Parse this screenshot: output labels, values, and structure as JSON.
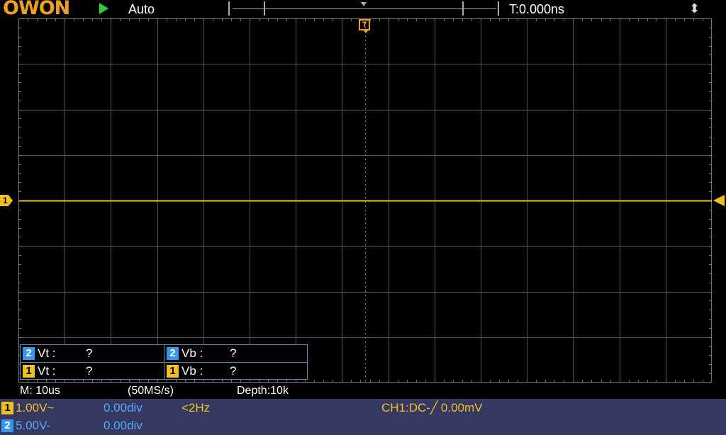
{
  "topbar": {
    "logo": "OWON",
    "trigger_mode": "Auto",
    "trigger_time": "T:0.000ns",
    "run_state_icon": "play-icon",
    "usb_icon": "usb-icon"
  },
  "markers": {
    "trigger_pos": "T",
    "ch1_ground": "1"
  },
  "measure": {
    "rows": [
      {
        "ch": "2",
        "a_label": "Vt :",
        "a_val": "?",
        "b_label": "Vb :",
        "b_val": "?"
      },
      {
        "ch": "1",
        "a_label": "Vt :",
        "a_val": "?",
        "b_label": "Vb :",
        "b_val": "?"
      }
    ]
  },
  "timebase": {
    "main": "M: 10us",
    "rate": "(50MS/s)",
    "depth": "Depth:10k"
  },
  "status": {
    "ch1": {
      "badge": "1",
      "scale": "1.00V~",
      "offset": "0.00div",
      "freq": "<2Hz",
      "trigger": "CH1:DC-╱ 0.00mV"
    },
    "ch2": {
      "badge": "2",
      "scale": "5.00V-",
      "offset": "0.00div"
    }
  },
  "colors": {
    "ch1": "#f0c020",
    "ch2": "#3399ee",
    "trigger": "#f0a020",
    "status_bg": "#353860",
    "grid": "#555555"
  }
}
